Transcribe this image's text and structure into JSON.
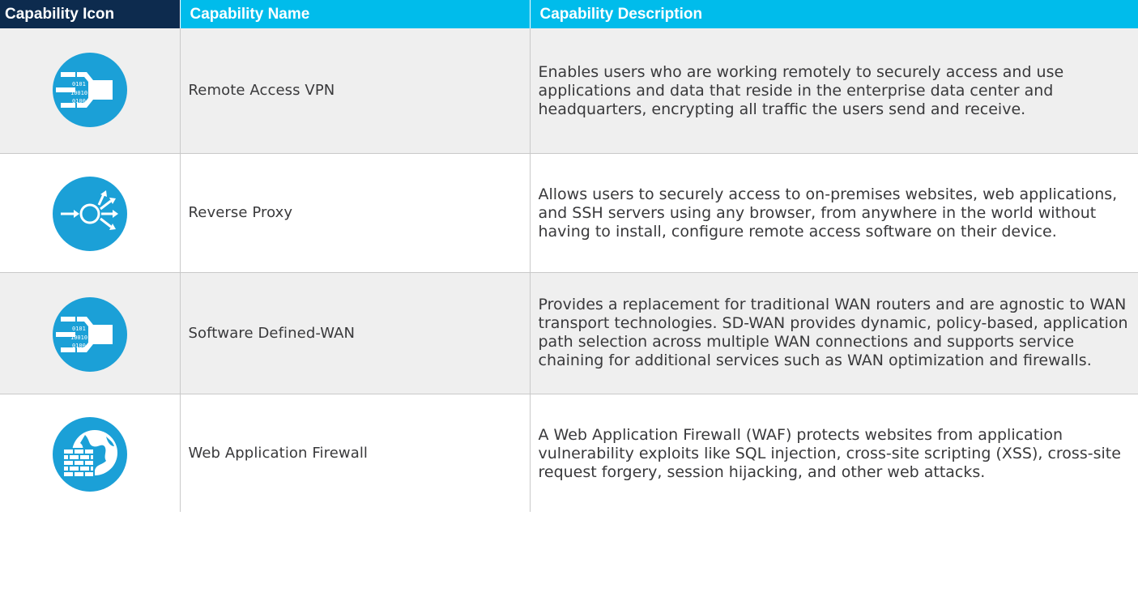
{
  "table": {
    "headers": {
      "icon": "Capability Icon",
      "name": "Capability Name",
      "description": "Capability Description"
    },
    "header_colors": {
      "icon": "#0d2b4e",
      "name": "#00bceb",
      "description": "#00bceb"
    },
    "icon_color": "#1ba0d7",
    "rows": [
      {
        "icon": "data-stream-funnel-icon",
        "name": "Remote Access VPN",
        "description": "Enables users who are working remotely to securely access and use applications and data that reside in the enterprise data center and headquarters, encrypting all traffic the users send and receive."
      },
      {
        "icon": "reverse-proxy-icon",
        "name": "Reverse Proxy",
        "description": "Allows users to securely access to on-premises websites, web applications, and SSH servers using any browser, from anywhere in the world without having to install, configure remote access software on their device."
      },
      {
        "icon": "data-stream-funnel-icon",
        "name": "Software Defined-WAN",
        "description": "Provides a replacement for traditional WAN routers and are agnostic to WAN transport technologies. SD-WAN provides dynamic, policy-based, application path selection across multiple WAN connections and supports service chaining for additional services such as WAN optimization and firewalls."
      },
      {
        "icon": "web-firewall-globe-icon",
        "name": "Web Application Firewall",
        "description": "A Web Application Firewall (WAF) protects websites from application vulnerability exploits like SQL injection, cross-site scripting (XSS), cross-site request forgery, session hijacking, and other web attacks."
      }
    ]
  }
}
